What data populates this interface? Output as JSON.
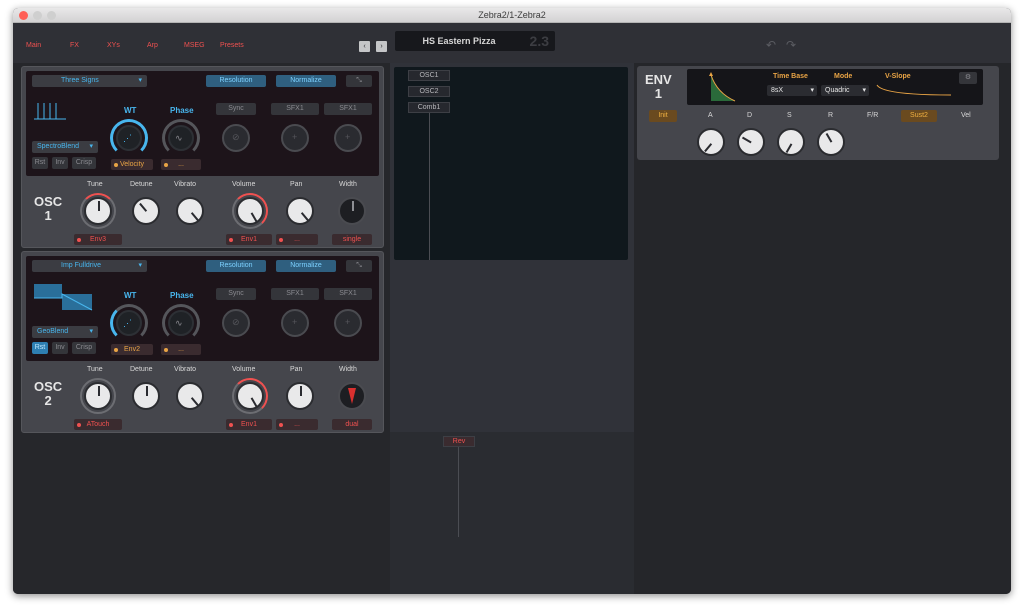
{
  "window": {
    "title": "Zebra2/1-Zebra2"
  },
  "menu": {
    "items": [
      "Main",
      "FX",
      "XYs",
      "Arp",
      "MSEG",
      "Presets"
    ]
  },
  "nav": {
    "prev": "‹",
    "next": "›"
  },
  "preset": {
    "name": "HS Eastern Pizza",
    "number": "2.3"
  },
  "toolbar": {
    "undo": "↶",
    "redo": "↷"
  },
  "osc1": {
    "label_line1": "OSC",
    "label_line2": "1",
    "waveform": "Three Signs",
    "resolution": "Resolution",
    "normalize": "Normalize",
    "wt": "WT",
    "phase": "Phase",
    "sync": "Sync",
    "sfx1a": "SFX1",
    "sfx1b": "SFX1",
    "blend": "SpectroBlend",
    "btn_rst": "Rst",
    "btn_inv": "Inv",
    "btn_crisp": "Crisp",
    "wt_mod": "Velocity",
    "phase_mod": "...",
    "knob_tune": "Tune",
    "knob_detune": "Detune",
    "knob_vibrato": "Vibrato",
    "knob_volume": "Volume",
    "knob_pan": "Pan",
    "knob_width": "Width",
    "tune_mod": "Env3",
    "volume_mod": "Env1",
    "pan_mod": "...",
    "width_mode": "single"
  },
  "osc2": {
    "label_line1": "OSC",
    "label_line2": "2",
    "waveform": "Imp Fulldrive",
    "resolution": "Resolution",
    "normalize": "Normalize",
    "wt": "WT",
    "phase": "Phase",
    "sync": "Sync",
    "sfx1a": "SFX1",
    "sfx1b": "SFX1",
    "blend": "GeoBlend",
    "btn_rst": "Rst",
    "btn_inv": "Inv",
    "btn_crisp": "Crisp",
    "wt_mod": "Env2",
    "phase_mod": "...",
    "knob_tune": "Tune",
    "knob_detune": "Detune",
    "knob_vibrato": "Vibrato",
    "knob_volume": "Volume",
    "knob_pan": "Pan",
    "knob_width": "Width",
    "tune_mod": "ATouch",
    "volume_mod": "Env1",
    "pan_mod": "...",
    "width_mode": "dual"
  },
  "grid": {
    "slots": [
      "OSC1",
      "OSC2",
      "Comb1"
    ]
  },
  "fx": {
    "slots": [
      "Rev"
    ]
  },
  "env1": {
    "label_line1": "ENV",
    "label_line2": "1",
    "time_base_label": "Time Base",
    "time_base": "8sX",
    "mode_label": "Mode",
    "mode": "Quadric",
    "vslope_label": "V-Slope",
    "init": "Init",
    "a": "A",
    "d": "D",
    "s": "S",
    "r": "R",
    "fr": "F/R",
    "sust": "Sust2",
    "vel": "Vel"
  },
  "colors": {
    "accent_blue": "#48b6ee",
    "accent_red": "#ef5150",
    "accent_orange": "#e9a445"
  }
}
